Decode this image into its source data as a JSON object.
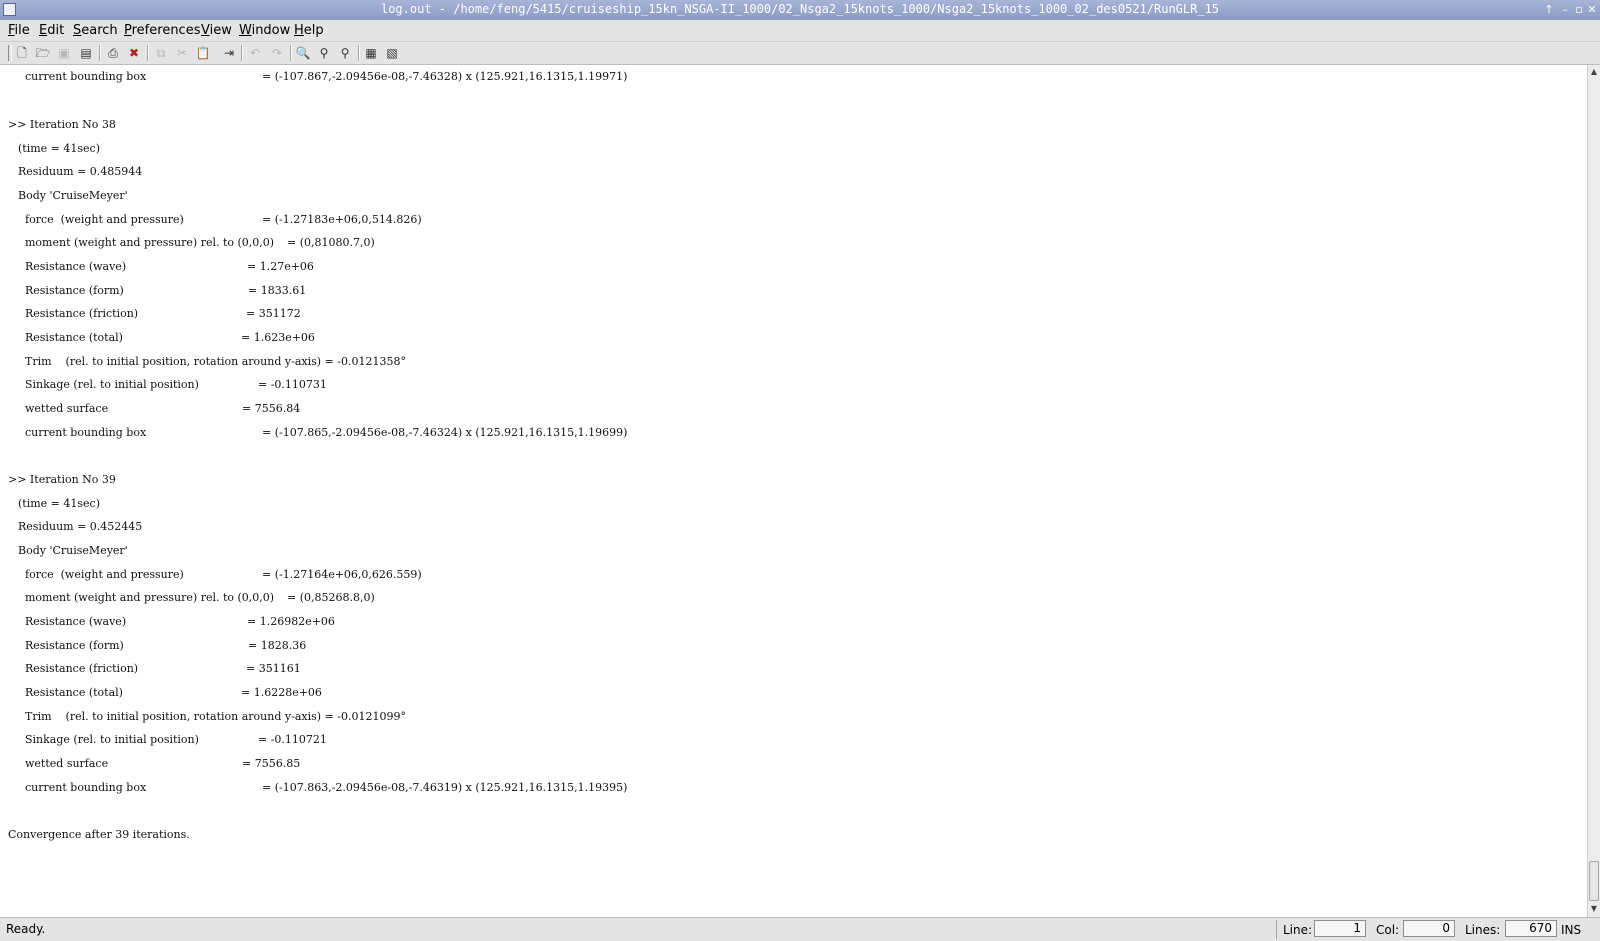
{
  "window": {
    "title": "log.out - /home/feng/5415/cruiseship_15kn_NSGA-II_1000/02_Nsga2_15knots_1000/Nsga2_15knots_1000_02_des0521/RunGLR_15",
    "controls": {
      "up": "↑",
      "minimize": "–",
      "maximize": "▫",
      "close": "✕"
    }
  },
  "menu": [
    {
      "pre": "",
      "key": "F",
      "post": "ile"
    },
    {
      "pre": "",
      "key": "E",
      "post": "dit"
    },
    {
      "pre": "",
      "key": "S",
      "post": "earch"
    },
    {
      "pre": "",
      "key": "P",
      "post": "references"
    },
    {
      "pre": "",
      "key": "V",
      "post": "iew"
    },
    {
      "pre": "",
      "key": "W",
      "post": "indow"
    },
    {
      "pre": "",
      "key": "H",
      "post": "elp"
    }
  ],
  "toolbar": {
    "buttons": [
      {
        "icon": "new-file-icon",
        "glyph": "🗋",
        "enabled": true
      },
      {
        "icon": "open-folder-icon",
        "glyph": "🗁",
        "enabled": true
      },
      {
        "icon": "save-icon",
        "glyph": "▣",
        "enabled": false
      },
      {
        "icon": "save-as-icon",
        "glyph": "▤",
        "enabled": true
      },
      {
        "icon": "print-icon",
        "glyph": "⎙",
        "enabled": true
      },
      {
        "icon": "close-file-icon",
        "glyph": "✖",
        "enabled": true
      },
      {
        "icon": "copy-icon",
        "glyph": "⧉",
        "enabled": false
      },
      {
        "icon": "cut-icon",
        "glyph": "✂",
        "enabled": false
      },
      {
        "icon": "paste-icon",
        "glyph": "📋",
        "enabled": true
      },
      {
        "icon": "goto-icon",
        "glyph": "⇥",
        "enabled": true
      },
      {
        "icon": "undo-icon",
        "glyph": "↶",
        "enabled": false
      },
      {
        "icon": "redo-icon",
        "glyph": "↷",
        "enabled": false
      },
      {
        "icon": "find-icon",
        "glyph": "🔍",
        "enabled": true
      },
      {
        "icon": "find-next-icon",
        "glyph": "⚲",
        "enabled": true
      },
      {
        "icon": "find-prev-icon",
        "glyph": "⚲",
        "enabled": true
      },
      {
        "icon": "shell-icon",
        "glyph": "▦",
        "enabled": true
      },
      {
        "icon": "macro-icon",
        "glyph": "▧",
        "enabled": true
      }
    ]
  },
  "log": {
    "lines": [
      "current bounding box",
      "= (-107.867,-2.09456e-08,-7.46328) x (125.921,16.1315,1.19971)",
      ">> Iteration No 38",
      "(time = 41sec)",
      "Residuum = 0.485944",
      "Body 'CruiseMeyer'",
      "force  (weight and pressure)",
      "= (-1.27183e+06,0,514.826)",
      "moment (weight and pressure) rel. to (0,0,0)",
      "= (0,81080.7,0)",
      "Resistance (wave)",
      "= 1.27e+06",
      "Resistance (form)",
      "= 1833.61",
      "Resistance (friction)",
      "= 351172",
      "Resistance (total)",
      "= 1.623e+06",
      "Trim    (rel. to initial position, rotation around y-axis) = -0.0121358°",
      "Sinkage (rel. to initial position)",
      "= -0.110731",
      "wetted surface",
      "= 7556.84",
      "current bounding box",
      "= (-107.865,-2.09456e-08,-7.46324) x (125.921,16.1315,1.19699)",
      ">> Iteration No 39",
      "(time = 41sec)",
      "Residuum = 0.452445",
      "Body 'CruiseMeyer'",
      "force  (weight and pressure)",
      "= (-1.27164e+06,0,626.559)",
      "moment (weight and pressure) rel. to (0,0,0)",
      "= (0,85268.8,0)",
      "Resistance (wave)",
      "= 1.26982e+06",
      "Resistance (form)",
      "= 1828.36",
      "Resistance (friction)",
      "= 351161",
      "Resistance (total)",
      "= 1.6228e+06",
      "Trim    (rel. to initial position, rotation around y-axis) = -0.0121099°",
      "Sinkage (rel. to initial position)",
      "= -0.110721",
      "wetted surface",
      "= 7556.85",
      "current bounding box",
      "= (-107.863,-2.09456e-08,-7.46319) x (125.921,16.1315,1.19395)",
      "Convergence after 39 iterations."
    ]
  },
  "scrollbar": {
    "up": "▲",
    "down": "▼"
  },
  "status": {
    "message": "Ready.",
    "line_label": "Line:",
    "line_value": "1",
    "col_label": "Col:",
    "col_value": "0",
    "lines_label": "Lines:",
    "lines_value": "670",
    "mode": "INS"
  }
}
